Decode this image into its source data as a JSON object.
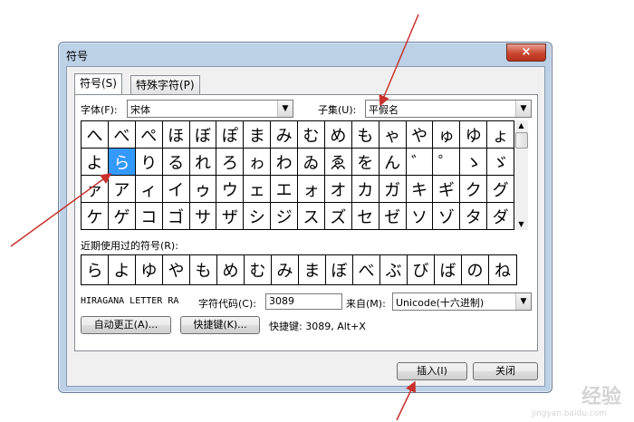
{
  "window": {
    "title": "符号",
    "close_symbol": "×"
  },
  "tabs": [
    {
      "label": "符号(S)",
      "active": true
    },
    {
      "label": "特殊字符(P)",
      "active": false
    }
  ],
  "font": {
    "label": "字体(F):",
    "value": "宋体"
  },
  "subset": {
    "label": "子集(U):",
    "value": "平假名"
  },
  "symbols": [
    "へ",
    "べ",
    "ぺ",
    "ほ",
    "ぼ",
    "ぽ",
    "ま",
    "み",
    "む",
    "め",
    "も",
    "ゃ",
    "や",
    "ゅ",
    "ゆ",
    "ょ",
    "よ",
    "ら",
    "り",
    "る",
    "れ",
    "ろ",
    "ゎ",
    "わ",
    "ゐ",
    "ゑ",
    "を",
    "ん",
    "゛",
    "゜",
    "ゝ",
    "ゞ",
    "ァ",
    "ア",
    "ィ",
    "イ",
    "ゥ",
    "ウ",
    "ェ",
    "エ",
    "ォ",
    "オ",
    "カ",
    "ガ",
    "キ",
    "ギ",
    "ク",
    "グ",
    "ケ",
    "ゲ",
    "コ",
    "ゴ",
    "サ",
    "ザ",
    "シ",
    "ジ",
    "ス",
    "ズ",
    "セ",
    "ゼ",
    "ソ",
    "ゾ",
    "タ",
    "ダ"
  ],
  "selected_index": 17,
  "recent": {
    "label": "近期使用过的符号(R):",
    "symbols": [
      "ら",
      "よ",
      "ゆ",
      "や",
      "も",
      "め",
      "む",
      "み",
      "ま",
      "ぼ",
      "べ",
      "ぶ",
      "び",
      "ば",
      "の",
      "ね"
    ]
  },
  "char_name": "HIRAGANA LETTER RA",
  "char_code": {
    "label": "字符代码(C):",
    "value": "3089"
  },
  "from": {
    "label": "来自(M):",
    "value": "Unicode(十六进制)"
  },
  "buttons": {
    "autocorrect": "自动更正(A)...",
    "shortcut_key": "快捷键(K)...",
    "shortcut_text": "快捷键: 3089, Alt+X",
    "insert": "插入(I)",
    "close": "关闭"
  },
  "watermark": {
    "main": "经验",
    "sub": "jingyan.baidu.com"
  },
  "colors": {
    "annotation_arrow": "#c8322c",
    "selection": "#3399ff",
    "frame": "#bcd0e6"
  }
}
